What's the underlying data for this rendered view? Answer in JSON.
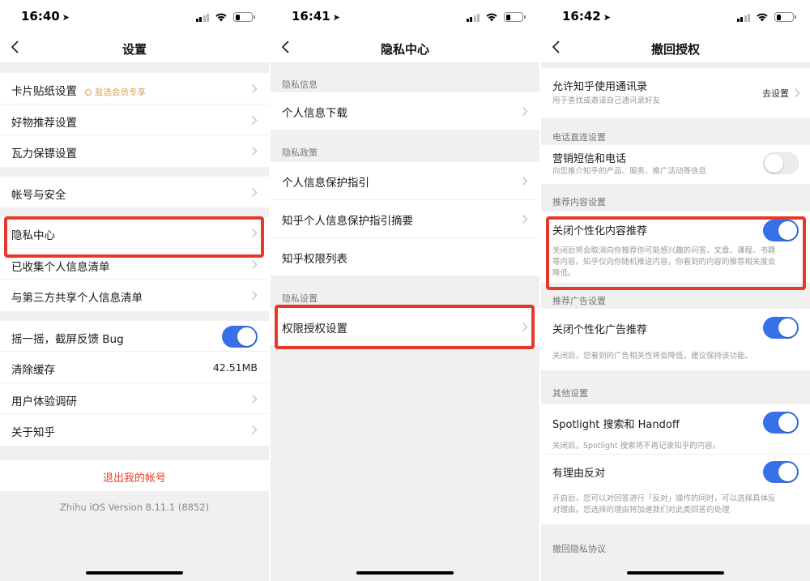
{
  "screens": [
    {
      "time": "16:40",
      "title": "设置",
      "groups": [
        [
          {
            "label": "卡片贴纸设置",
            "badge": "盐选会员专享"
          },
          {
            "label": "好物推荐设置"
          },
          {
            "label": "瓦力保镖设置"
          }
        ],
        [
          {
            "label": "帐号与安全"
          }
        ],
        [
          {
            "label": "隐私中心"
          },
          {
            "label": "已收集个人信息清单"
          },
          {
            "label": "与第三方共享个人信息清单"
          }
        ],
        [
          {
            "label": "摇一摇，截屏反馈 Bug"
          },
          {
            "label": "清除缓存",
            "value": "42.51MB"
          },
          {
            "label": "用户体验调研"
          },
          {
            "label": "关于知乎"
          }
        ]
      ],
      "logout": "退出我的帐号",
      "version": "Zhihu iOS Version 8.11.1 (8852)"
    },
    {
      "time": "16:41",
      "title": "隐私中心",
      "sections": [
        {
          "header": "隐私信息",
          "items": [
            "个人信息下载"
          ]
        },
        {
          "header": "隐私政策",
          "items": [
            "个人信息保护指引",
            "知乎个人信息保护指引摘要",
            "知乎权限列表"
          ]
        },
        {
          "header": "隐私设置",
          "items": [
            "权限授权设置"
          ]
        }
      ]
    },
    {
      "time": "16:42",
      "title": "撤回授权",
      "contacts": {
        "title": "允许知乎使用通讯录",
        "desc": "用于查找或邀请自己通讯录好友",
        "value": "去设置"
      },
      "sections": [
        {
          "header": "电话直连设置",
          "title": "营销短信和电话",
          "desc": [
            "向您推介知乎的产品、服务、推广活动等信息"
          ],
          "on": false
        },
        {
          "header": "推荐内容设置",
          "title": "关闭个性化内容推荐",
          "desc": [
            "关闭后将会取消向你推荐你可能感兴趣的问答、文章、课程、书籍",
            "等内容。知乎仅向你随机推送内容，你看到的内容的推荐相关度会",
            "降低。"
          ],
          "on": true
        },
        {
          "header": "推荐广告设置",
          "title": "关闭个性化广告推荐",
          "desc": [
            "关闭后，您看到的广告相关性将会降低，建议保持该功能。"
          ],
          "on": true
        },
        {
          "header": "其他设置",
          "title": "Spotlight 搜索和 Handoff",
          "desc": [
            "关闭后，Spotlight 搜索将不再记录知乎的内容。"
          ],
          "on": true
        },
        {
          "header": "",
          "title": "有理由反对",
          "desc": [
            "开启后，您可以对回答进行「反对」操作的同时，可以选择具体反",
            "对理由。您选择的理由将加速我们对此类回答的处理"
          ],
          "on": true
        }
      ],
      "footer_header": "撤回隐私协议"
    }
  ],
  "colors": {
    "accent": "#3770e8",
    "highlight": "#e53a2a",
    "logout": "#e5412e",
    "badge": "#d8a04c"
  }
}
